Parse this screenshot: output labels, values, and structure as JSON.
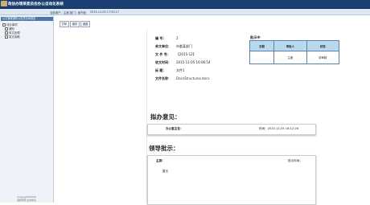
{
  "app": {
    "title": "政协办理某委员会办公自动化系统"
  },
  "statusbar": {
    "user_info": "当前用户：主席    部门：秘书处",
    "date": "2015-11-05 17:33:17"
  },
  "sidebar": {
    "header": "公文管理通知公告签名和报告",
    "group": "待办事项",
    "items": [
      {
        "label": "通知"
      },
      {
        "label": "收文处理"
      },
      {
        "label": "发文拟稿"
      }
    ],
    "footer": [
      "Copyright©2015",
      "版权所有 主办单位"
    ]
  },
  "toolbar": {
    "buttons": [
      {
        "label": "打印"
      },
      {
        "label": "保存"
      },
      {
        "label": "返回"
      }
    ]
  },
  "document": {
    "fields": [
      {
        "label": "编    号：",
        "value": "2"
      },
      {
        "label": "来文单位：",
        "value": "市委某部门"
      },
      {
        "label": "文 件 号：",
        "value": "【2015-12】"
      },
      {
        "label": "收文时间：",
        "value": "2015-11-05 16:06:54"
      },
      {
        "label": "标    题：",
        "value": "文件1"
      },
      {
        "label": "文件名称：",
        "value": "DocxStructures.docx"
      }
    ],
    "notice_title": "批示中",
    "sign_table": {
      "headers": [
        "日期",
        "审批人",
        "状态"
      ],
      "rows": [
        [
          "",
          "主席",
          "待审核"
        ]
      ]
    },
    "opinion": {
      "title": "拟办意见：",
      "label": "办公室主任：",
      "time": "时间：2015-11-05 16:12:26"
    },
    "leader": {
      "title": "领导批示：",
      "label": "主席：",
      "hint": "批示时间：",
      "content": "暂无"
    }
  },
  "colors": {
    "titlebar": "#1b3f72",
    "table_header": "#b9d9ee",
    "table_border": "#5c7fa8"
  }
}
